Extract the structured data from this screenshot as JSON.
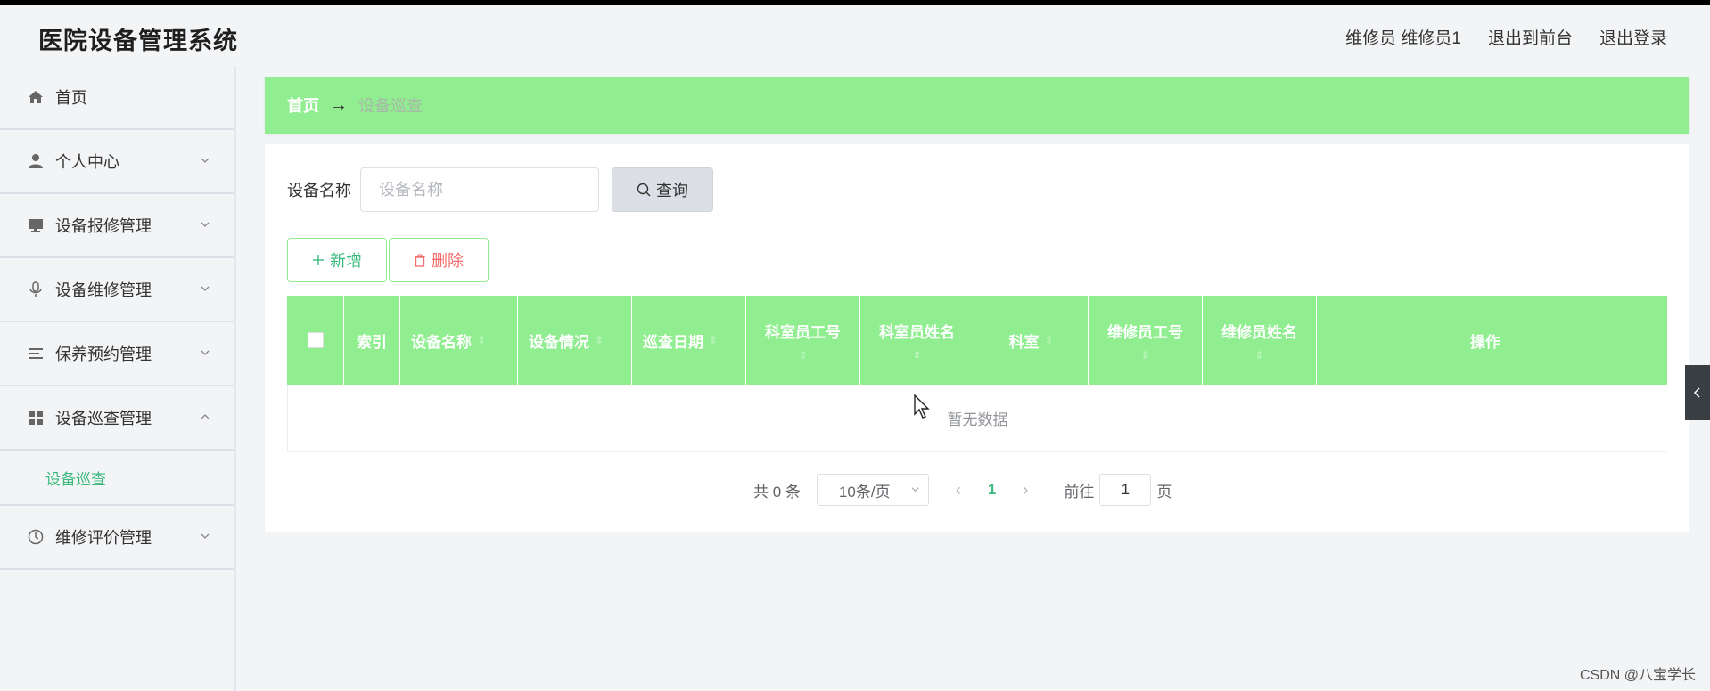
{
  "app": {
    "title": "医院设备管理系统"
  },
  "header": {
    "user": "维修员 维修员1",
    "to_front": "退出到前台",
    "logout": "退出登录"
  },
  "sidebar": {
    "items": [
      {
        "label": "首页",
        "icon": "home-icon"
      },
      {
        "label": "个人中心",
        "icon": "user-icon"
      },
      {
        "label": "设备报修管理",
        "icon": "monitor-icon"
      },
      {
        "label": "设备维修管理",
        "icon": "microphone-icon"
      },
      {
        "label": "保养预约管理",
        "icon": "list-icon"
      },
      {
        "label": "设备巡查管理",
        "icon": "grid-icon",
        "expanded": true
      },
      {
        "label": "维修评价管理",
        "icon": "clock-icon"
      }
    ],
    "sub_active": "设备巡查"
  },
  "breadcrumb": {
    "home": "首页",
    "arrow": "→",
    "current": "设备巡查"
  },
  "search": {
    "label": "设备名称",
    "placeholder": "设备名称",
    "button": "查询"
  },
  "actions": {
    "add": "新增",
    "delete": "删除"
  },
  "table": {
    "columns": [
      {
        "label": "索引"
      },
      {
        "label": "设备名称"
      },
      {
        "label": "设备情况"
      },
      {
        "label": "巡查日期"
      },
      {
        "label": "科室员工号"
      },
      {
        "label": "科室员姓名"
      },
      {
        "label": "科室"
      },
      {
        "label": "维修员工号"
      },
      {
        "label": "维修员姓名"
      },
      {
        "label": "操作"
      }
    ],
    "empty_text": "暂无数据"
  },
  "pagination": {
    "total": "共 0 条",
    "page_size": "10条/页",
    "current_page": "1",
    "goto_prefix": "前往",
    "goto_value": "1",
    "goto_suffix": "页"
  },
  "watermark": "CSDN @八宝学长",
  "colors": {
    "accent": "#90ee90",
    "active_text": "#3cba7e",
    "danger": "#f56c6c"
  }
}
